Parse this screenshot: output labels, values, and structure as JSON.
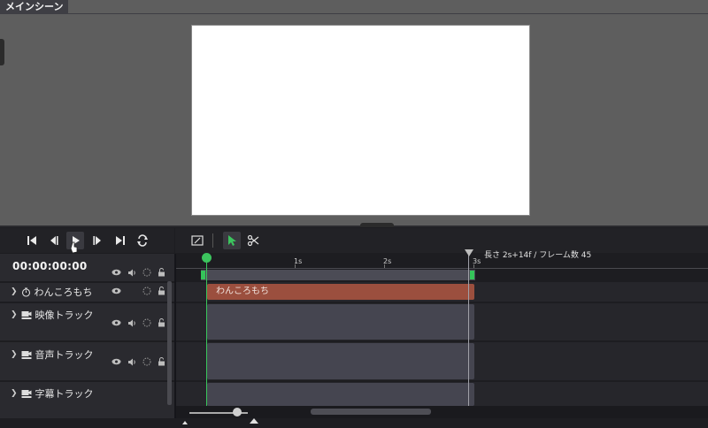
{
  "scene_tab": {
    "title": "メインシーン"
  },
  "timecode": "00:00:00:00",
  "length_info": "長さ 2s+14f / フレーム数 45",
  "ruler": {
    "ticks": [
      "1s",
      "2s",
      "3s"
    ]
  },
  "tracks": [
    {
      "label": "わんころもち",
      "icon": "timer-icon"
    },
    {
      "label": "映像トラック",
      "icon": "video-track-icon"
    },
    {
      "label": "音声トラック",
      "icon": "audio-track-icon"
    },
    {
      "label": "字幕トラック",
      "icon": "subtitle-track-icon"
    }
  ],
  "clips": {
    "object_clip_label": "わんころもち"
  },
  "colors": {
    "playhead": "#3cc45e",
    "object_clip": "#9b4f3e",
    "accent_select": "#3cc45e"
  }
}
